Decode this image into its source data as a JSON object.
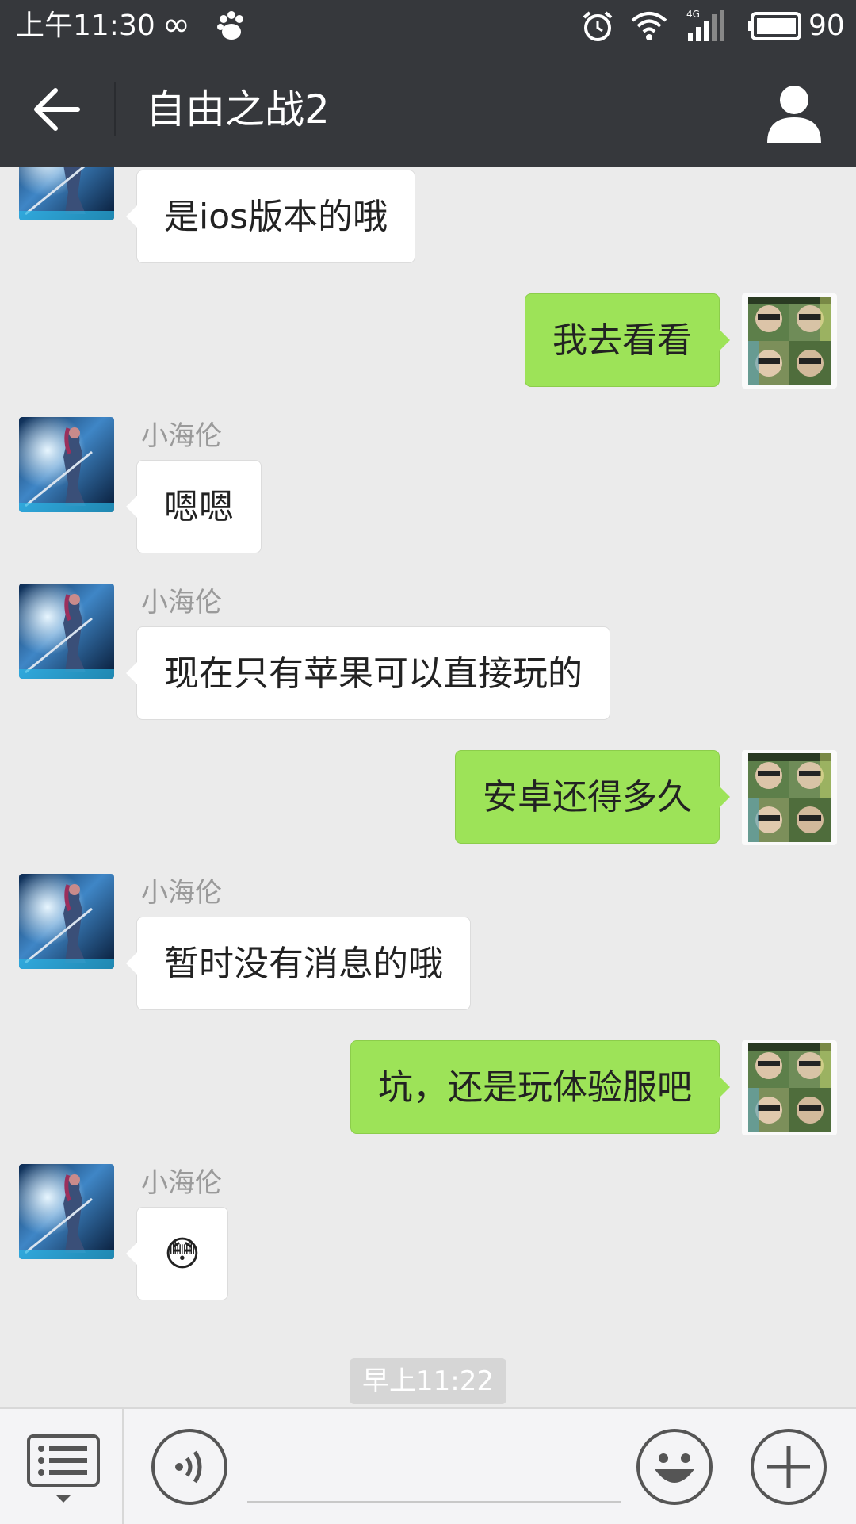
{
  "status_bar": {
    "time": "上午11:30",
    "network_type": "4G",
    "battery_level": "90",
    "icons": [
      "infinity-icon",
      "baidu-paw-icon",
      "alarm-icon",
      "wifi-icon",
      "signal-icon",
      "battery-icon"
    ]
  },
  "header": {
    "title": "自由之战2",
    "back_icon": "back-arrow-icon",
    "profile_icon": "person-icon"
  },
  "messages": [
    {
      "side": "in",
      "text": "是ios版本的哦"
    },
    {
      "side": "out",
      "text": "我去看看"
    },
    {
      "side": "in",
      "sender": "小海伦",
      "text": "嗯嗯"
    },
    {
      "side": "in",
      "sender": "小海伦",
      "text": "现在只有苹果可以直接玩的"
    },
    {
      "side": "out",
      "text": "安卓还得多久"
    },
    {
      "side": "in",
      "sender": "小海伦",
      "text": "暂时没有消息的哦"
    },
    {
      "side": "out",
      "text": "坑，还是玩体验服吧"
    },
    {
      "side": "in",
      "sender": "小海伦",
      "text": "😳"
    }
  ],
  "timestamp": "早上11:22",
  "input_bar": {
    "value": "",
    "icons": [
      "menu-list-icon",
      "voice-icon",
      "emoji-icon",
      "plus-icon"
    ]
  },
  "colors": {
    "bar_bg": "#36383c",
    "chat_bg": "#ebebeb",
    "bubble_out": "#9de358",
    "bubble_in": "#ffffff"
  }
}
